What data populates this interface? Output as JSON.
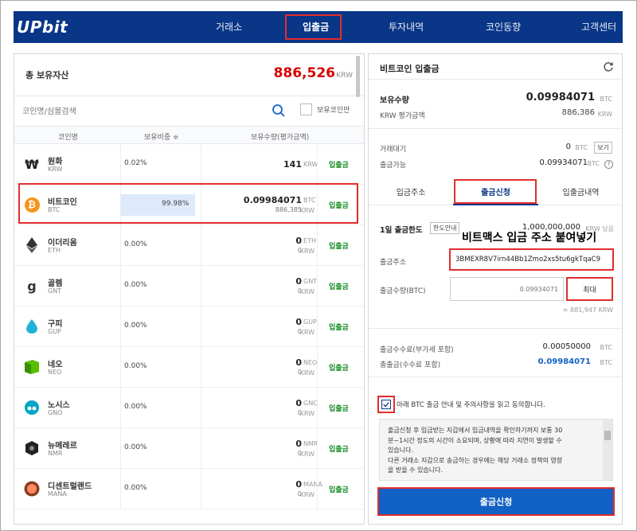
{
  "nav": {
    "logo": "UPbit",
    "items": [
      "거래소",
      "입출금",
      "투자내역",
      "코인동향",
      "고객센터"
    ],
    "active": "입출금"
  },
  "assets": {
    "total_label": "총 보유자산",
    "total_value": "886,526",
    "total_unit": "KRW",
    "search_placeholder": "코인명/심볼검색",
    "owned_only_label": "보유코인만",
    "headers": [
      "코인명",
      "보유비중 ≑",
      "보유수량(평가금액)"
    ],
    "coins": [
      {
        "name": "원화",
        "symbol": "KRW",
        "pct": "0.02%",
        "amount": "141",
        "amount_unit": "KRW",
        "krw": "",
        "krw_unit": "",
        "action": "입출금"
      },
      {
        "name": "비트코인",
        "symbol": "BTC",
        "pct": "99.98%",
        "amount": "0.09984071",
        "amount_unit": "BTC",
        "krw": "886,385",
        "krw_unit": "KRW",
        "action": "입출금"
      },
      {
        "name": "이더리움",
        "symbol": "ETH",
        "pct": "0.00%",
        "amount": "0",
        "amount_unit": "ETH",
        "krw": "0",
        "krw_unit": "KRW",
        "action": "입출금"
      },
      {
        "name": "골렘",
        "symbol": "GNT",
        "pct": "0.00%",
        "amount": "0",
        "amount_unit": "GNT",
        "krw": "0",
        "krw_unit": "KRW",
        "action": "입출금"
      },
      {
        "name": "구피",
        "symbol": "GUP",
        "pct": "0.00%",
        "amount": "0",
        "amount_unit": "GUP",
        "krw": "0",
        "krw_unit": "KRW",
        "action": "입출금"
      },
      {
        "name": "네오",
        "symbol": "NEO",
        "pct": "0.00%",
        "amount": "0",
        "amount_unit": "NEO",
        "krw": "0",
        "krw_unit": "KRW",
        "action": "입출금"
      },
      {
        "name": "노시스",
        "symbol": "GNO",
        "pct": "0.00%",
        "amount": "0",
        "amount_unit": "GNO",
        "krw": "0",
        "krw_unit": "KRW",
        "action": "입출금"
      },
      {
        "name": "뉴메레르",
        "symbol": "NMR",
        "pct": "0.00%",
        "amount": "0",
        "amount_unit": "NMR",
        "krw": "0",
        "krw_unit": "KRW",
        "action": "입출금"
      },
      {
        "name": "디센트럴랜드",
        "symbol": "MANA",
        "pct": "0.00%",
        "amount": "0",
        "amount_unit": "MANA",
        "krw": "0",
        "krw_unit": "KRW",
        "action": "입출금"
      }
    ],
    "coin_icons": [
      "won-icon",
      "bitcoin-icon",
      "ethereum-icon",
      "golem-icon",
      "gup-icon",
      "neo-icon",
      "gnosis-icon",
      "numeraire-icon",
      "decentraland-icon"
    ]
  },
  "withdraw": {
    "title": "비트코인 입출금",
    "holding_label": "보유수량",
    "holding_value": "0.09984071",
    "holding_unit": "BTC",
    "krw_eval_label": "KRW 평가금액",
    "krw_eval_value": "886,386",
    "krw_eval_unit": "KRW",
    "pending_label": "거래대기",
    "pending_value": "0",
    "pending_unit": "BTC",
    "pending_button": "보기",
    "available_label": "출금가능",
    "available_value": "0.09934071",
    "available_unit": "BTC",
    "help": "?",
    "tabs": [
      "입금주소",
      "출금신청",
      "입출금내역"
    ],
    "active_tab": "출금신청",
    "daily_limit_label": "1일 출금한도",
    "limit_guide_button": "한도안내",
    "daily_limit_value": "1,000,000,000",
    "daily_limit_suffix": "KRW 남음",
    "callout": "비트맥스 입금 주소 붙여넣기",
    "address_label": "출금주소",
    "address_value": "3BMEXR8V7irn44Bb1Zmo2xs5tu6gkTqaC9",
    "amount_label": "출금수량(BTC)",
    "amount_placeholder": "0.09934071",
    "max_button": "최대",
    "approx_krw": "≈ 881,947 KRW",
    "fee_label": "출금수수료(부가세 포함)",
    "fee_value": "0.00050000",
    "fee_unit": "BTC",
    "total_label": "총출금(수수료 포함)",
    "total_value": "0.09984071",
    "total_unit": "BTC",
    "agree_label": "아래 BTC 출금 안내 및 주의사항을 읽고 동의합니다.",
    "notice_lines": [
      "출금신청 후 입금받는 지갑에서 입금내역을 확인하기까지 보통 30",
      "분~1시간 정도의 시간이 소요되며, 상황에 따라 지연이 발생할 수",
      "있습니다.",
      "다른 거래소 지갑으로 송금하는 경우에는 해당 거래소 정책의 영향",
      "을 받을 수 있습니다."
    ],
    "submit_button": "출금신청"
  },
  "colors": {
    "brand": "#093687",
    "highlight": "#e12d2d",
    "positive": "#d60000",
    "deposit_link": "#108a1e",
    "submit": "#1261c4"
  }
}
